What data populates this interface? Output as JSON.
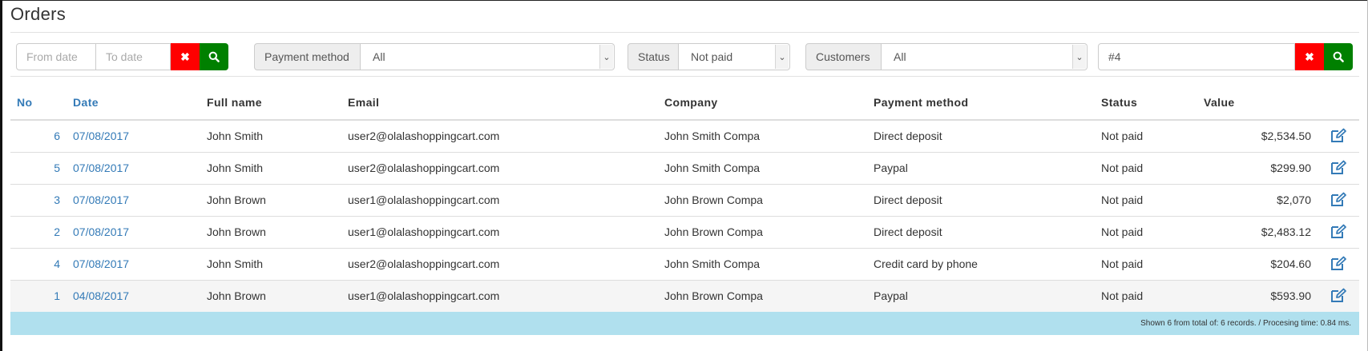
{
  "page": {
    "title": "Orders"
  },
  "filters": {
    "from_date_placeholder": "From date",
    "to_date_placeholder": "To date",
    "payment_method_label": "Payment method",
    "payment_method_value": "All",
    "status_label": "Status",
    "status_value": "Not paid",
    "customers_label": "Customers",
    "customers_value": "All",
    "search_value": "#4",
    "clear_icon": "✖",
    "search_icon": "search-icon"
  },
  "table": {
    "headers": [
      "No",
      "Date",
      "Full name",
      "Email",
      "Company",
      "Payment method",
      "Status",
      "Value"
    ],
    "rows": [
      {
        "no": "6",
        "date": "07/08/2017",
        "full_name": "John Smith",
        "email": "user2@olalashoppingcart.com",
        "company": "John Smith Compa",
        "payment": "Direct deposit",
        "status": "Not paid",
        "value": "$2,534.50"
      },
      {
        "no": "5",
        "date": "07/08/2017",
        "full_name": "John Smith",
        "email": "user2@olalashoppingcart.com",
        "company": "John Smith Compa",
        "payment": "Paypal",
        "status": "Not paid",
        "value": "$299.90"
      },
      {
        "no": "3",
        "date": "07/08/2017",
        "full_name": "John Brown",
        "email": "user1@olalashoppingcart.com",
        "company": "John Brown Compa",
        "payment": "Direct deposit",
        "status": "Not paid",
        "value": "$2,070"
      },
      {
        "no": "2",
        "date": "07/08/2017",
        "full_name": "John Brown",
        "email": "user1@olalashoppingcart.com",
        "company": "John Brown Compa",
        "payment": "Direct deposit",
        "status": "Not paid",
        "value": "$2,483.12"
      },
      {
        "no": "4",
        "date": "07/08/2017",
        "full_name": "John Smith",
        "email": "user2@olalashoppingcart.com",
        "company": "John Smith Compa",
        "payment": "Credit card by phone",
        "status": "Not paid",
        "value": "$204.60"
      },
      {
        "no": "1",
        "date": "04/08/2017",
        "full_name": "John Brown",
        "email": "user1@olalashoppingcart.com",
        "company": "John Brown Compa",
        "payment": "Paypal",
        "status": "Not paid",
        "value": "$593.90"
      }
    ]
  },
  "footer": {
    "text": "Shown 6 from total of: 6 records. / Procesing time: 0.84 ms."
  },
  "colors": {
    "link": "#337ab7",
    "clear_button": "#ff0000",
    "search_button": "#008000",
    "footer_bg": "#b0e0ee",
    "edit_icon": "#337ab7"
  }
}
